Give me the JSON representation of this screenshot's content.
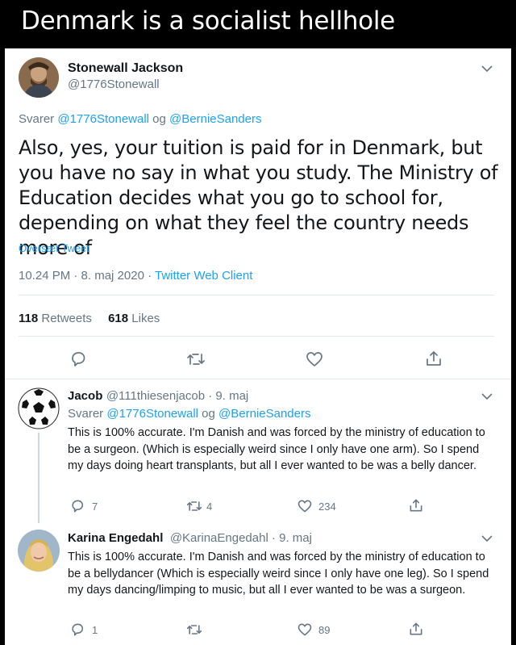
{
  "meme": {
    "title": "Denmark is a socialist hellhole"
  },
  "main_tweet": {
    "name": "Stonewall Jackson",
    "handle": "@1776Stonewall",
    "reply_prefix": "Svarer",
    "reply_user1": "@1776Stonewall",
    "reply_og": "og",
    "reply_user2": "@BernieSanders",
    "text": "Also, yes, your tuition is paid for in Denmark, but you have no say in what you study. The Ministry of Education decides what you go to school for, depending on what they feel the country needs more of",
    "translate": "Oversæt Tweet",
    "time": "10.24 PM · 8. maj 2020 · ",
    "client": "Twitter Web Client",
    "retweets_count": "118",
    "retweets_label": "Retweets",
    "likes_count": "618",
    "likes_label": "Likes"
  },
  "replies": [
    {
      "name": "Jacob",
      "handle_date": "@111thiesenjacob · 9. maj",
      "reply_prefix": "Svarer",
      "reply_user1": "@1776Stonewall",
      "reply_og": "og",
      "reply_user2": "@BernieSanders",
      "text": "This is 100% accurate. I'm Danish and was forced by the ministry of education to be a surgeon. (Which is especially weird since I only have one arm). So I spend my days doing heart transplants, but all I ever wanted to be was a belly dancer.",
      "reply_count": "7",
      "retweet_count": "4",
      "like_count": "234"
    },
    {
      "name": "Karina Engedahl",
      "handle_date": "@KarinaEngedahl · 9. maj",
      "text": "This is 100% accurate. I'm Danish and was forced by the ministry of education to be a bellydancer  (Which is especially weird since I only have one leg). So I spend my days dancing/limping to music, but all I ever wanted to be was a surgeon.",
      "reply_count": "1",
      "retweet_count": "",
      "like_count": "89"
    }
  ],
  "icons": [
    "reply-icon",
    "retweet-icon",
    "like-icon",
    "share-icon",
    "chevron-down-icon"
  ],
  "colors": {
    "accent": "#1da1f2",
    "text": "#14171a",
    "muted": "#657786",
    "border": "#e1e8ed"
  }
}
